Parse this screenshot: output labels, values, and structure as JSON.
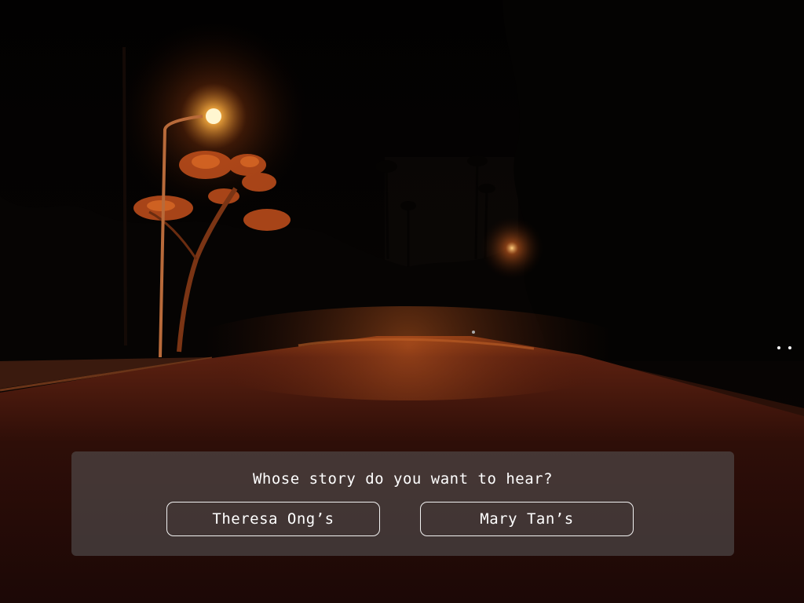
{
  "dialog": {
    "prompt": "Whose story do you want to hear?",
    "choices": [
      {
        "label": "Theresa Ong’s"
      },
      {
        "label": "Mary Tan’s"
      }
    ]
  },
  "colors": {
    "streetlight": "#ffb347",
    "road_glow": "#6a2410",
    "panel": "#5a5a5a",
    "text": "#ffffff"
  }
}
